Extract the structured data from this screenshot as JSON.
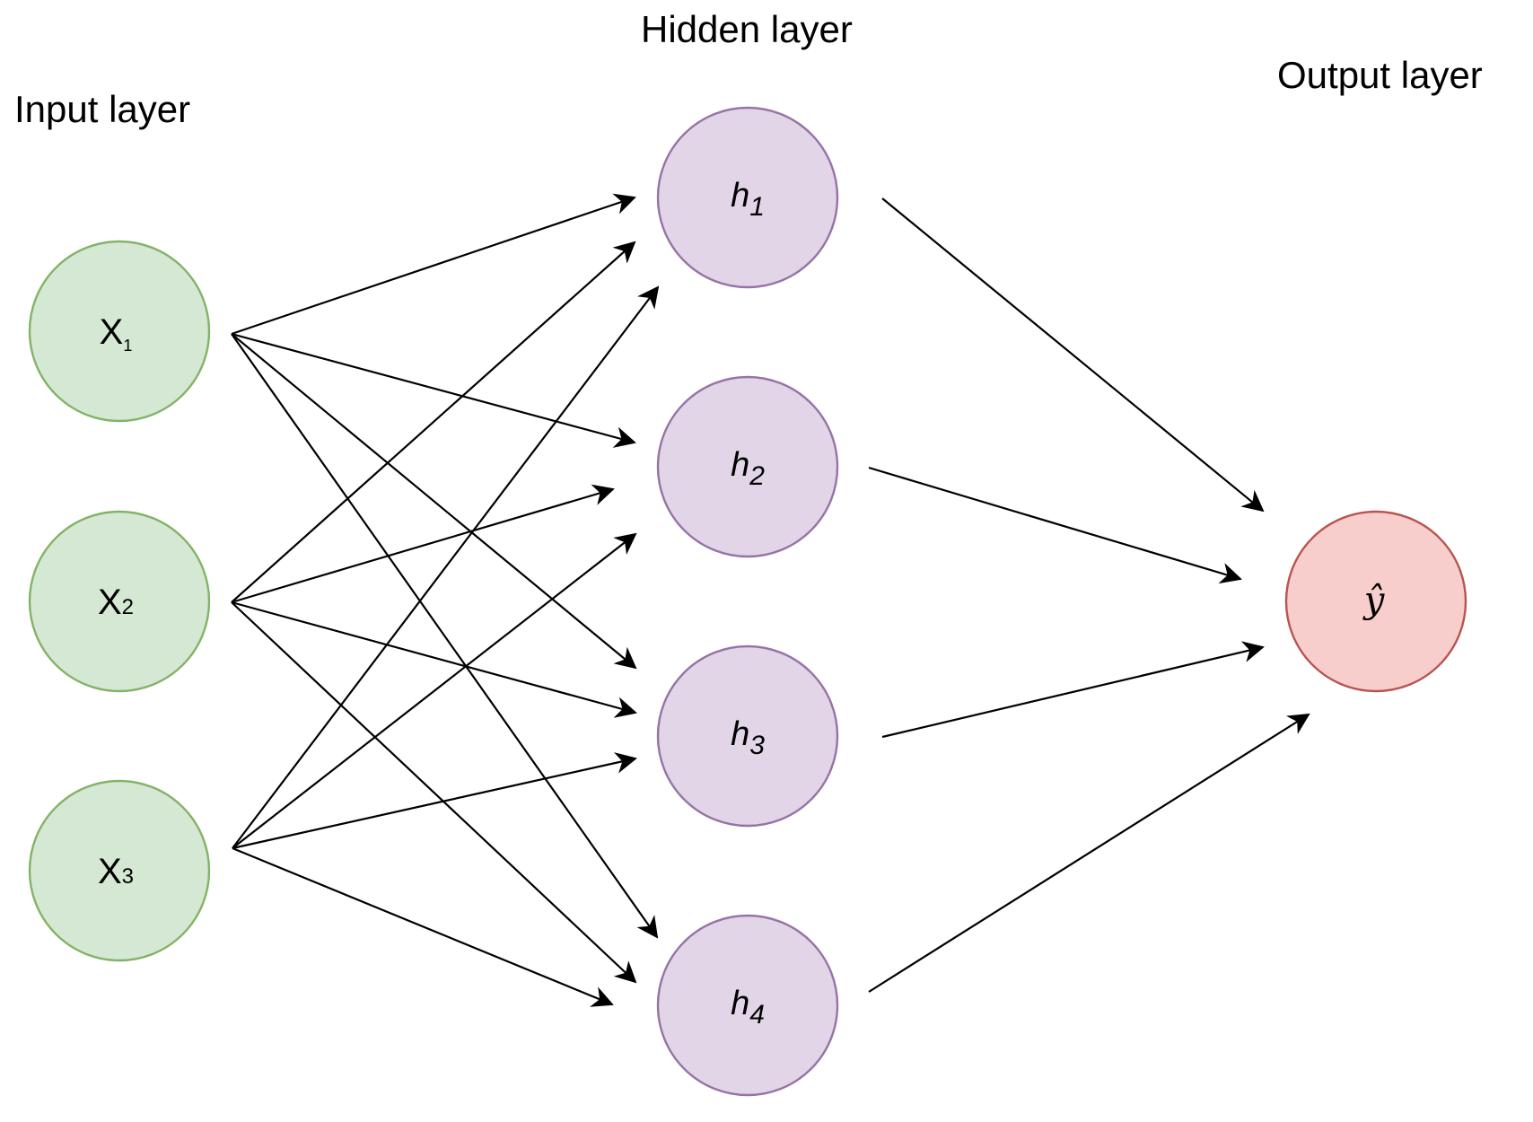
{
  "layers": {
    "input": {
      "title": "Input layer"
    },
    "hidden": {
      "title": "Hidden layer"
    },
    "output": {
      "title": "Output layer"
    }
  },
  "nodes": {
    "input": [
      {
        "id": "x1",
        "base": "X",
        "sub": "1"
      },
      {
        "id": "x2",
        "base": "X",
        "sub": "2"
      },
      {
        "id": "x3",
        "base": "X",
        "sub": "3"
      }
    ],
    "hidden": [
      {
        "id": "h1",
        "base": "h",
        "sub": "1"
      },
      {
        "id": "h2",
        "base": "h",
        "sub": "2"
      },
      {
        "id": "h3",
        "base": "h",
        "sub": "3"
      },
      {
        "id": "h4",
        "base": "h",
        "sub": "4"
      }
    ],
    "output": [
      {
        "id": "yhat",
        "base": "ŷ",
        "sub": ""
      }
    ]
  },
  "edges": [
    {
      "from": "x1",
      "to": "h1"
    },
    {
      "from": "x1",
      "to": "h2"
    },
    {
      "from": "x1",
      "to": "h3"
    },
    {
      "from": "x1",
      "to": "h4"
    },
    {
      "from": "x2",
      "to": "h1"
    },
    {
      "from": "x2",
      "to": "h2"
    },
    {
      "from": "x2",
      "to": "h3"
    },
    {
      "from": "x2",
      "to": "h4"
    },
    {
      "from": "x3",
      "to": "h1"
    },
    {
      "from": "x3",
      "to": "h2"
    },
    {
      "from": "x3",
      "to": "h3"
    },
    {
      "from": "x3",
      "to": "h4"
    },
    {
      "from": "h1",
      "to": "yhat"
    },
    {
      "from": "h2",
      "to": "yhat"
    },
    {
      "from": "h3",
      "to": "yhat"
    },
    {
      "from": "h4",
      "to": "yhat"
    }
  ],
  "colors": {
    "input_fill": "#d5e8d4",
    "input_stroke": "#82b366",
    "hidden_fill": "#e1d5e7",
    "hidden_stroke": "#9673a6",
    "output_fill": "#f8cecc",
    "output_stroke": "#b85450",
    "edge": "#000000"
  }
}
